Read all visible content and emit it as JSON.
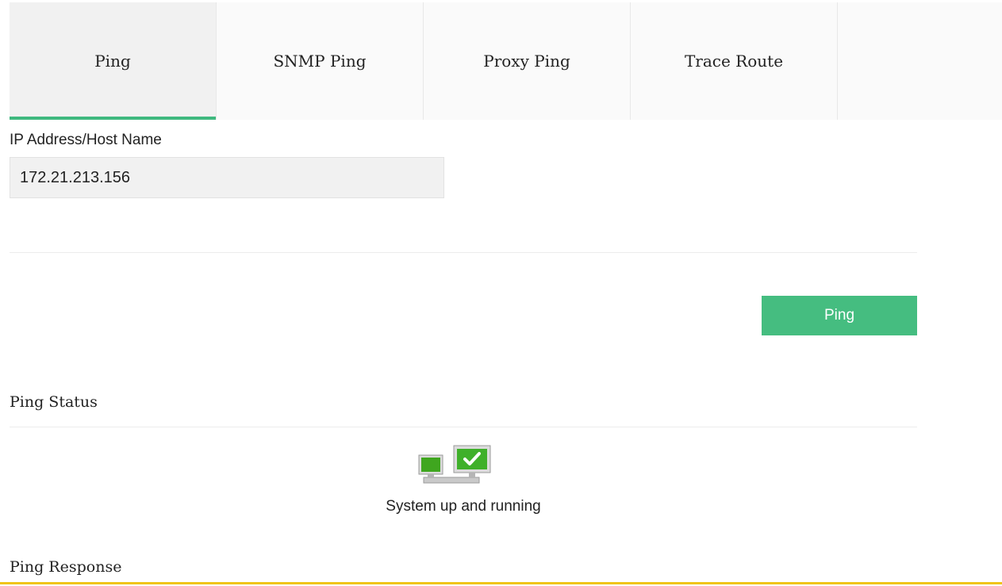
{
  "tabs": [
    {
      "label": "Ping",
      "active": true
    },
    {
      "label": "SNMP Ping",
      "active": false
    },
    {
      "label": "Proxy Ping",
      "active": false
    },
    {
      "label": "Trace Route",
      "active": false
    }
  ],
  "form": {
    "ip_label": "IP Address/Host Name",
    "ip_value": "172.21.213.156"
  },
  "actions": {
    "ping_button_label": "Ping"
  },
  "status": {
    "heading": "Ping Status",
    "icon": "network-up-icon",
    "text": "System up and running"
  },
  "response": {
    "heading": "Ping Response"
  },
  "colors": {
    "accent": "#45bd80",
    "active_tab_underline": "#3fb97f",
    "bottom_border": "#f0c419"
  }
}
